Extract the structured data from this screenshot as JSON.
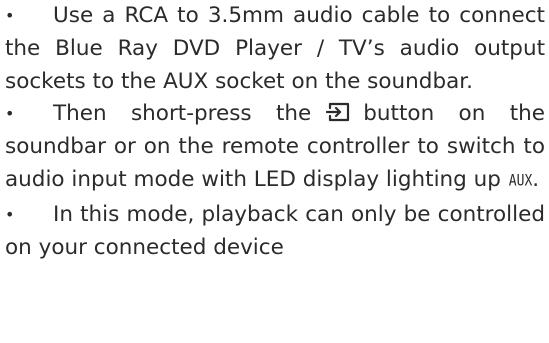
{
  "bullets": {
    "symbol": "•",
    "item1": {
      "text": "Use a RCA to 3.5mm audio cable to connect the Blue Ray DVD Player / TV’s audio output sockets to the AUX socket on the soundbar."
    },
    "item2": {
      "text_before_icon": "Then short-press the",
      "icon": "input-source-icon",
      "text_after_icon": "button on the soundbar or on the remote controller to switch to audio input mode with LED display lighting up",
      "led_text": "AUX",
      "text_end": "."
    },
    "item3": {
      "text": "In this mode, playback can only be controlled on your connected device"
    }
  }
}
